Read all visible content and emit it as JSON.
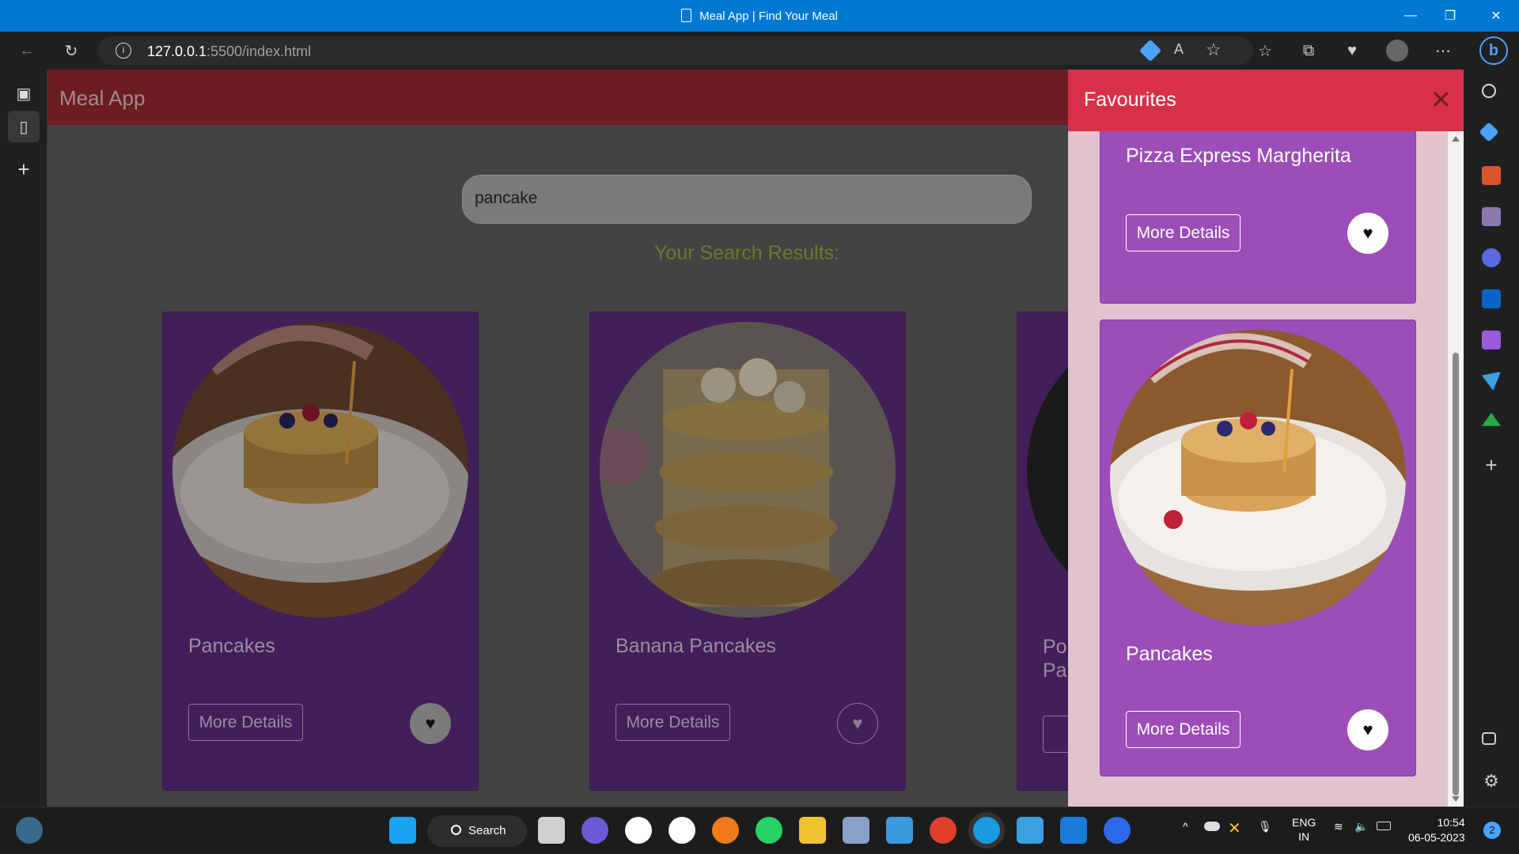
{
  "window": {
    "title": "Meal App | Find Your Meal"
  },
  "browser": {
    "url_host": "127.0.0.1",
    "url_path": ":5500/index.html"
  },
  "app": {
    "title": "Meal App",
    "search_value": "pancake",
    "results_title": "Your Search Results:",
    "cards": [
      {
        "name": "Pancakes",
        "more_label": "More Details",
        "favourited": true
      },
      {
        "name": "Banana Pancakes",
        "more_label": "More Details",
        "favourited": false
      },
      {
        "name": "Po Pa",
        "name_line1": "Po",
        "name_line2": "Pa",
        "more_label": "M"
      }
    ]
  },
  "favourites": {
    "title": "Favourites",
    "close_label": "✕",
    "items": [
      {
        "name": "Pizza Express Margherita",
        "more_label": "More Details"
      },
      {
        "name": "Pancakes",
        "more_label": "More Details"
      }
    ]
  },
  "taskbar": {
    "search_label": "Search",
    "lang_line1": "ENG",
    "lang_line2": "IN",
    "time": "10:54",
    "date": "06-05-2023",
    "notifications": "2"
  },
  "colors": {
    "titlebar": "#0078d4",
    "app_header": "#6d1c22",
    "card_bg_dimmed": "#431f59",
    "fav_header": "#d9304a",
    "fav_card": "#9c4db8",
    "fav_panel_bg": "#e0c3cc"
  }
}
